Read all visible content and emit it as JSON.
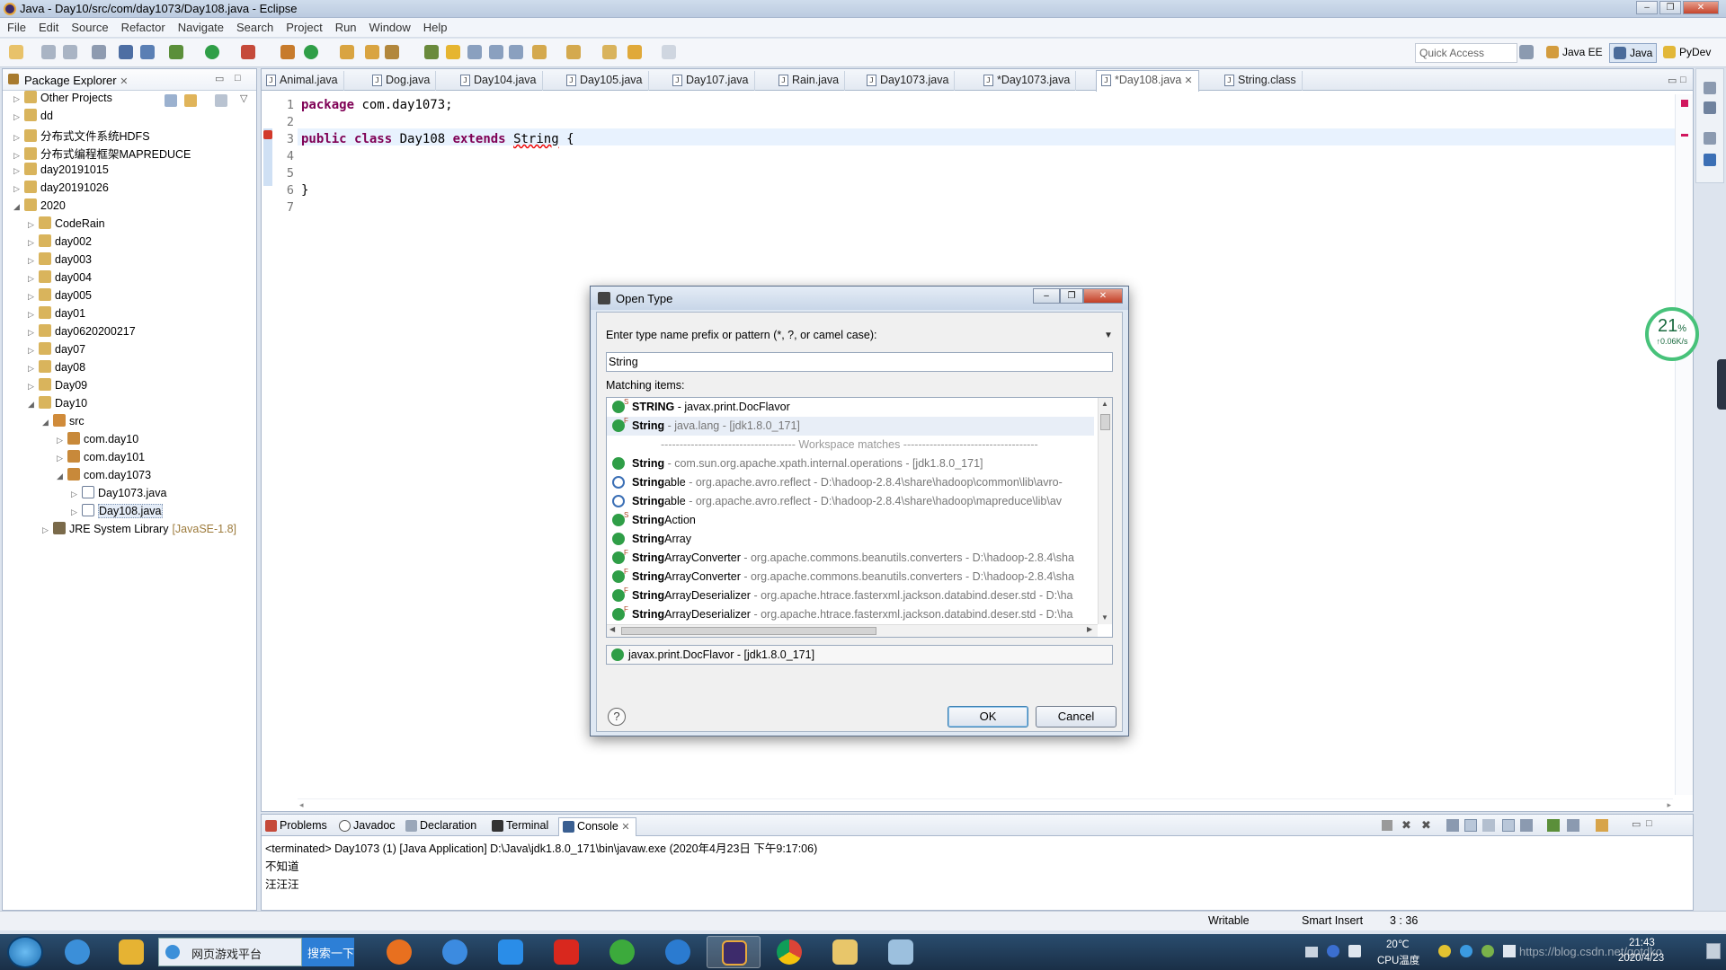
{
  "window": {
    "title": "Java - Day10/src/com/day1073/Day108.java - Eclipse"
  },
  "menu": [
    "File",
    "Edit",
    "Source",
    "Refactor",
    "Navigate",
    "Search",
    "Project",
    "Run",
    "Window",
    "Help"
  ],
  "toolbar": {
    "quick_access": "Quick Access",
    "perspectives": [
      "Java EE",
      "Java",
      "PyDev"
    ]
  },
  "package_explorer": {
    "title": "Package Explorer",
    "tree": [
      {
        "label": "Other Projects",
        "depth": 0,
        "arrow": "▷"
      },
      {
        "label": "dd",
        "depth": 0,
        "arrow": "▷"
      },
      {
        "label": "分布式文件系统HDFS",
        "depth": 0,
        "arrow": "▷"
      },
      {
        "label": "分布式编程框架MAPREDUCE",
        "depth": 0,
        "arrow": "▷"
      },
      {
        "label": "day20191015",
        "depth": 0,
        "arrow": "▷"
      },
      {
        "label": "day20191026",
        "depth": 0,
        "arrow": "▷"
      },
      {
        "label": "2020",
        "depth": 0,
        "arrow": "◢"
      },
      {
        "label": "CodeRain",
        "depth": 1,
        "arrow": "▷"
      },
      {
        "label": "day002",
        "depth": 1,
        "arrow": "▷"
      },
      {
        "label": "day003",
        "depth": 1,
        "arrow": "▷"
      },
      {
        "label": "day004",
        "depth": 1,
        "arrow": "▷"
      },
      {
        "label": "day005",
        "depth": 1,
        "arrow": "▷"
      },
      {
        "label": "day01",
        "depth": 1,
        "arrow": "▷"
      },
      {
        "label": "day0620200217",
        "depth": 1,
        "arrow": "▷"
      },
      {
        "label": "day07",
        "depth": 1,
        "arrow": "▷"
      },
      {
        "label": "day08",
        "depth": 1,
        "arrow": "▷"
      },
      {
        "label": "Day09",
        "depth": 1,
        "arrow": "▷"
      },
      {
        "label": "Day10",
        "depth": 1,
        "arrow": "◢"
      },
      {
        "label": "src",
        "depth": 2,
        "arrow": "◢"
      },
      {
        "label": "com.day10",
        "depth": 3,
        "arrow": "▷"
      },
      {
        "label": "com.day101",
        "depth": 3,
        "arrow": "▷"
      },
      {
        "label": "com.day1073",
        "depth": 3,
        "arrow": "◢"
      },
      {
        "label": "Day1073.java",
        "depth": 4,
        "arrow": "▷"
      },
      {
        "label": "Day108.java",
        "depth": 4,
        "arrow": "▷",
        "selected": true
      },
      {
        "label": "JRE System Library",
        "depth": 2,
        "arrow": "▷",
        "suffix": "[JavaSE-1.8]"
      }
    ]
  },
  "editor_tabs": [
    "Animal.java",
    "Dog.java",
    "Day104.java",
    "Day105.java",
    "Day107.java",
    "Rain.java",
    "Day1073.java",
    "*Day1073.java",
    "*Day108.java",
    "String.class"
  ],
  "code": {
    "line_numbers": [
      "1",
      "2",
      "3",
      "4",
      "5",
      "6",
      "7"
    ],
    "line1_kw": "package",
    "line1_rest": " com.day1073;",
    "line3_kw1": "public",
    "line3_kw2": "class",
    "line3_name": " Day108 ",
    "line3_kw3": "extends",
    "line3_type": "String",
    "line3_brace": " {",
    "line6": "}"
  },
  "console": {
    "tabs": [
      "Problems",
      "Javadoc",
      "Declaration",
      "Terminal",
      "Console"
    ],
    "header": "<terminated> Day1073 (1) [Java Application] D:\\Java\\jdk1.8.0_171\\bin\\javaw.exe (2020年4月23日 下午9:17:06)",
    "lines": [
      "不知道",
      "汪汪汪"
    ]
  },
  "status": {
    "writable": "Writable",
    "insert": "Smart Insert",
    "position": "3 : 36"
  },
  "network_widget": {
    "percent": "21",
    "percent_sign": "%",
    "speed": "↑0.06K/s"
  },
  "dialog": {
    "title": "Open Type",
    "prompt": "Enter type name prefix or pattern (*, ?, or camel case):",
    "input_value": "String",
    "matching_label": "Matching items:",
    "items": [
      {
        "bold": "STRING",
        "rest": " - javax.print.DocFlavor",
        "sup": "S",
        "gray": false
      },
      {
        "bold": "String",
        "rest": " - java.lang - [jdk1.8.0_171]",
        "sup": "F",
        "gray": true,
        "selected": true
      },
      {
        "separator": "------------------------------------ Workspace matches ------------------------------------"
      },
      {
        "bold": "String",
        "rest": " - com.sun.org.apache.xpath.internal.operations - [jdk1.8.0_171]",
        "sup": "",
        "gray": true
      },
      {
        "bold": "String",
        "tail": "able",
        "rest": " - org.apache.avro.reflect - D:\\hadoop-2.8.4\\share\\hadoop\\common\\lib\\avro-",
        "sup": "",
        "gray": true,
        "ann": true
      },
      {
        "bold": "String",
        "tail": "able",
        "rest": " - org.apache.avro.reflect - D:\\hadoop-2.8.4\\share\\hadoop\\mapreduce\\lib\\av",
        "sup": "",
        "gray": true,
        "ann": true
      },
      {
        "bold": "String",
        "tail": "Action",
        "rest": "",
        "sup": "S",
        "gray": false
      },
      {
        "bold": "String",
        "tail": "Array",
        "rest": "",
        "sup": "",
        "gray": false
      },
      {
        "bold": "String",
        "tail": "ArrayConverter",
        "rest": " - org.apache.commons.beanutils.converters - D:\\hadoop-2.8.4\\sha",
        "sup": "F",
        "gray": true
      },
      {
        "bold": "String",
        "tail": "ArrayConverter",
        "rest": " - org.apache.commons.beanutils.converters - D:\\hadoop-2.8.4\\sha",
        "sup": "F",
        "gray": true
      },
      {
        "bold": "String",
        "tail": "ArrayDeserializer",
        "rest": " - org.apache.htrace.fasterxml.jackson.databind.deser.std - D:\\ha",
        "sup": "F",
        "gray": true
      },
      {
        "bold": "String",
        "tail": "ArrayDeserializer",
        "rest": " - org.apache.htrace.fasterxml.jackson.databind.deser.std - D:\\ha",
        "sup": "F",
        "gray": true
      }
    ],
    "detail": "javax.print.DocFlavor - [jdk1.8.0_171]",
    "ok_label": "OK",
    "cancel_label": "Cancel",
    "help_label": "?"
  },
  "taskbar": {
    "search_text": "网页游戏平台",
    "search_button": "搜索一下",
    "temperature": "20℃",
    "cpu_label": "CPU温度",
    "time": "21:43",
    "date": "2020/4/23",
    "watermark": "https://blog.csdn.net/gotdko"
  }
}
